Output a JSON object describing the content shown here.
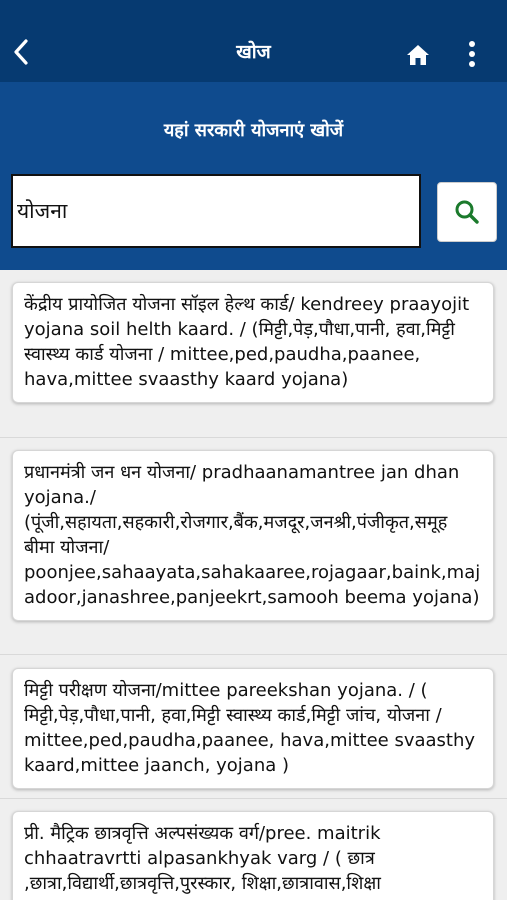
{
  "header": {
    "title": "खोज",
    "back_icon": "chevron-left-icon",
    "home_icon": "home-icon",
    "menu_icon": "more-vertical-icon",
    "background": "#063a71"
  },
  "search": {
    "heading": "यहां सरकारी योजनाएं खोजें",
    "value": "योजना",
    "button_icon": "search-icon",
    "panel_color": "#0f4b8e",
    "icon_color": "#1b7a2c"
  },
  "results": [
    {
      "text": "केंद्रीय प्रायोजित योजना सॉइल हेल्थ कार्ड/ kendreey praayojit yojana soil helth kaard. / (मिट्टी,पेड़,पौधा,पानी, हवा,मिट्टी स्वास्थ्य कार्ड योजना / mittee,ped,paudha,paanee, hava,mittee svaasthy kaard yojana)"
    },
    {
      "text": "प्रधानमंत्री जन धन योजना/ pradhaanamantree jan dhan yojana./ (पूंजी,सहायता,सहकारी,रोजगार,बैंक,मजदूर,जनश्री,पंजीकृत,समूह बीमा योजना/ poonjee,sahaayata,sahakaaree,rojagaar,baink,majadoor,janashree,panjeekrt,samooh beema yojana)"
    },
    {
      "text": "मिट्टी परीक्षण योजना/mittee pareekshan yojana. / ( मिट्टी,पेड़,पौधा,पानी, हवा,मिट्टी स्वास्थ्य कार्ड,मिट्टी जांच, योजना / mittee,ped,paudha,paanee, hava,mittee svaasthy kaard,mittee jaanch, yojana )"
    },
    {
      "text": "प्री. मैट्रिक छात्रवृत्ति अल्पसंख्यक वर्ग/pree. maitrik chhaatravrtti alpasankhyak varg / ( छात्र ,छात्रा,विद्यार्थी,छात्रवृत्ति,पुरस्कार, शिक्षा,छात्रावास,शिक्षा"
    }
  ]
}
